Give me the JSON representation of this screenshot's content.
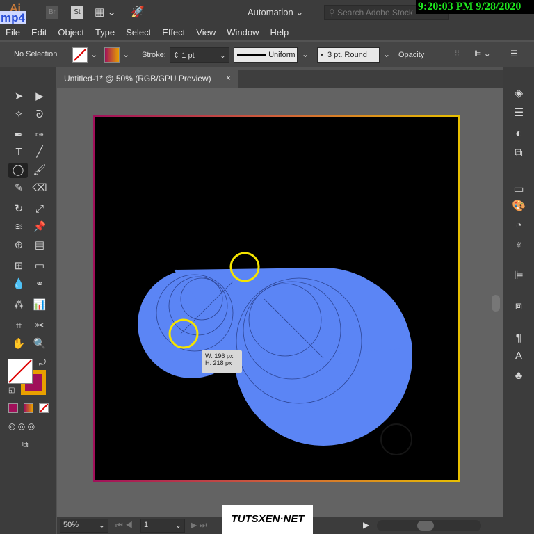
{
  "app": {
    "logo": "Ai",
    "overlay": "mp4",
    "bridge": "Br",
    "stock": "St",
    "workspace": "Automation",
    "search_placeholder": "Search Adobe Stock",
    "clock": "9:20:03 PM 9/28/2020"
  },
  "menu": [
    "File",
    "Edit",
    "Object",
    "Type",
    "Select",
    "Effect",
    "View",
    "Window",
    "Help"
  ],
  "control": {
    "selection": "No Selection",
    "stroke_label": "Stroke:",
    "stroke_weight": "1 pt",
    "profile": "Uniform",
    "brush": "3 pt. Round",
    "opacity_label": "Opacity"
  },
  "document": {
    "tab_title": "Untitled-1* @ 50% (RGB/GPU Preview)",
    "close": "×"
  },
  "tooltip": {
    "width": "W: 196 px",
    "height": "H: 218 px"
  },
  "status": {
    "zoom": "50%",
    "artboard": "1"
  },
  "watermark": "TUTSXEN·NET",
  "colors": {
    "shape": "#5b85f5",
    "highlight": "#f5e400",
    "artboard": "#000000",
    "border_start": "#a0105a",
    "border_end": "#e8c000"
  }
}
